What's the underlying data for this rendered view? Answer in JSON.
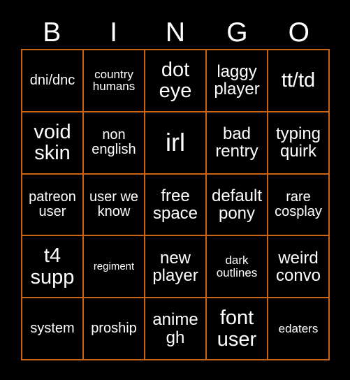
{
  "card": {
    "header_letters": [
      "B",
      "I",
      "N",
      "G",
      "O"
    ],
    "border_color": "#c86414",
    "background_color": "#000000",
    "text_color": "#ffffff",
    "rows": [
      [
        {
          "text": "dni/dnc",
          "size": "md"
        },
        {
          "text": "country humans",
          "size": "sm"
        },
        {
          "text": "dot eye",
          "size": "xl"
        },
        {
          "text": "laggy player",
          "size": "lg"
        },
        {
          "text": "tt/td",
          "size": "xl"
        }
      ],
      [
        {
          "text": "void skin",
          "size": "xl"
        },
        {
          "text": "non english",
          "size": "md"
        },
        {
          "text": "irl",
          "size": "xxl"
        },
        {
          "text": "bad rentry",
          "size": "lg"
        },
        {
          "text": "typing quirk",
          "size": "lg"
        }
      ],
      [
        {
          "text": "patreon user",
          "size": "md"
        },
        {
          "text": "user we know",
          "size": "md"
        },
        {
          "text": "free space",
          "size": "lg"
        },
        {
          "text": "default pony",
          "size": "lg"
        },
        {
          "text": "rare cosplay",
          "size": "md"
        }
      ],
      [
        {
          "text": "t4 supp",
          "size": "xl"
        },
        {
          "text": "regiment",
          "size": "xs"
        },
        {
          "text": "new player",
          "size": "lg"
        },
        {
          "text": "dark outlines",
          "size": "sm"
        },
        {
          "text": "weird convo",
          "size": "lg"
        }
      ],
      [
        {
          "text": "system",
          "size": "md"
        },
        {
          "text": "proship",
          "size": "md"
        },
        {
          "text": "anime gh",
          "size": "lg"
        },
        {
          "text": "font user",
          "size": "xl"
        },
        {
          "text": "edaters",
          "size": "sm"
        }
      ]
    ]
  }
}
